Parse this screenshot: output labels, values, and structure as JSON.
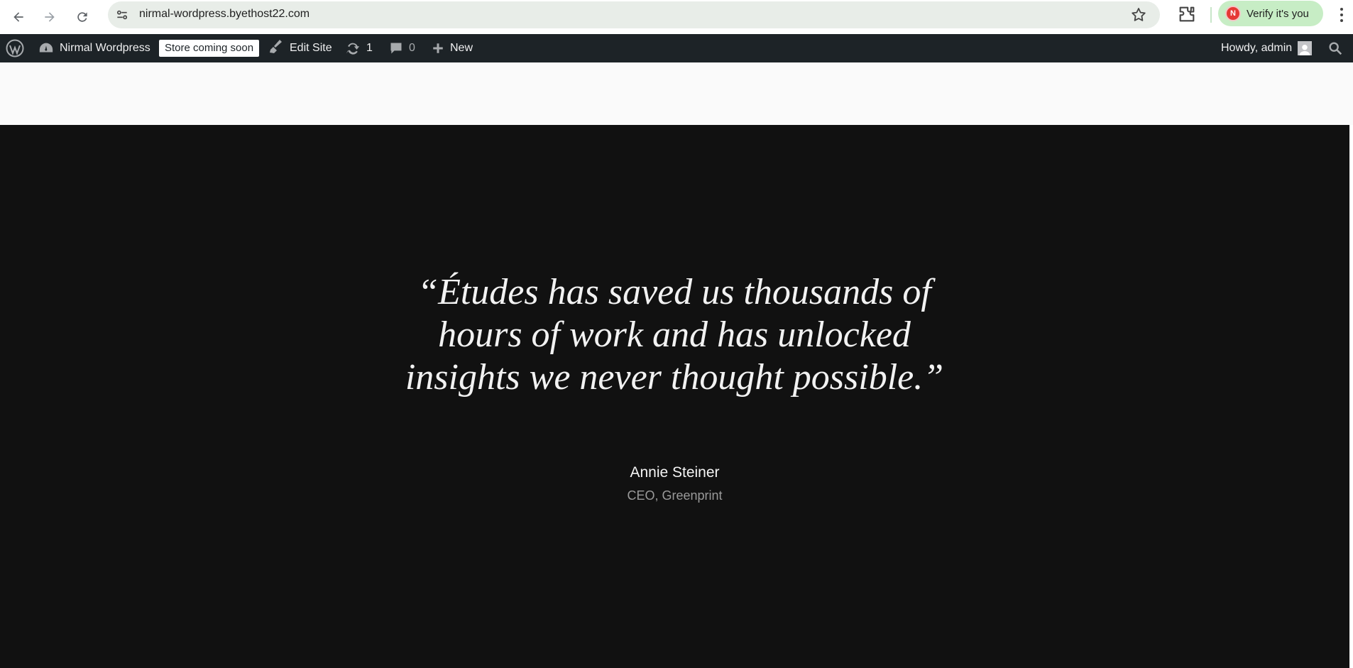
{
  "browser": {
    "url": "nirmal-wordpress.byethost22.com",
    "verify_label": "Verify it's you",
    "profile_initial": "N"
  },
  "adminbar": {
    "site_name": "Nirmal Wordpress",
    "store_badge": "Store coming soon",
    "edit_site": "Edit Site",
    "updates_count": "1",
    "comments_count": "0",
    "new_label": "New",
    "howdy": "Howdy, admin"
  },
  "testimonial": {
    "quote": "“Études has saved us thousands of hours of work and has unlocked insights we never thought possible.”",
    "author": "Annie Steiner",
    "role": "CEO, Greenprint"
  },
  "colors": {
    "adminbar_bg": "#1d2327",
    "section_bg": "#111111",
    "verify_pill": "#c7edc5"
  }
}
